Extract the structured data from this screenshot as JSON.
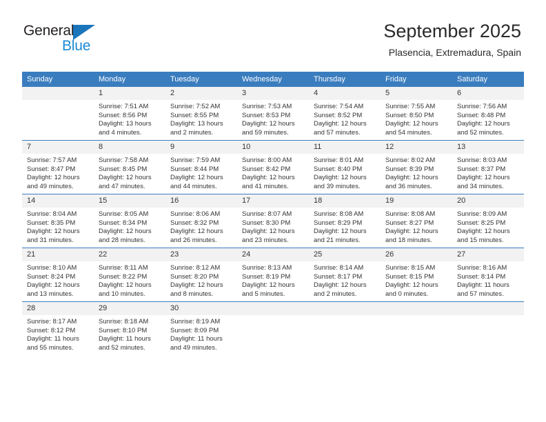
{
  "brand": {
    "name_top": "General",
    "name_bottom": "Blue",
    "accent_color": "#1b75bb",
    "accent_color_light": "#1b8ad4"
  },
  "header": {
    "title": "September 2025",
    "location": "Plasencia, Extremadura, Spain"
  },
  "theme": {
    "header_row_bg": "#3a7dbf",
    "daynum_bg": "#f2f2f2",
    "text_color": "#333333"
  },
  "weekday_headers": [
    "Sunday",
    "Monday",
    "Tuesday",
    "Wednesday",
    "Thursday",
    "Friday",
    "Saturday"
  ],
  "weeks": [
    [
      {
        "day": "",
        "empty": true,
        "sunrise": "",
        "sunset": "",
        "daylight_1": "",
        "daylight_2": ""
      },
      {
        "day": "1",
        "sunrise": "Sunrise: 7:51 AM",
        "sunset": "Sunset: 8:56 PM",
        "daylight_1": "Daylight: 13 hours",
        "daylight_2": "and 4 minutes."
      },
      {
        "day": "2",
        "sunrise": "Sunrise: 7:52 AM",
        "sunset": "Sunset: 8:55 PM",
        "daylight_1": "Daylight: 13 hours",
        "daylight_2": "and 2 minutes."
      },
      {
        "day": "3",
        "sunrise": "Sunrise: 7:53 AM",
        "sunset": "Sunset: 8:53 PM",
        "daylight_1": "Daylight: 12 hours",
        "daylight_2": "and 59 minutes."
      },
      {
        "day": "4",
        "sunrise": "Sunrise: 7:54 AM",
        "sunset": "Sunset: 8:52 PM",
        "daylight_1": "Daylight: 12 hours",
        "daylight_2": "and 57 minutes."
      },
      {
        "day": "5",
        "sunrise": "Sunrise: 7:55 AM",
        "sunset": "Sunset: 8:50 PM",
        "daylight_1": "Daylight: 12 hours",
        "daylight_2": "and 54 minutes."
      },
      {
        "day": "6",
        "sunrise": "Sunrise: 7:56 AM",
        "sunset": "Sunset: 8:48 PM",
        "daylight_1": "Daylight: 12 hours",
        "daylight_2": "and 52 minutes."
      }
    ],
    [
      {
        "day": "7",
        "sunrise": "Sunrise: 7:57 AM",
        "sunset": "Sunset: 8:47 PM",
        "daylight_1": "Daylight: 12 hours",
        "daylight_2": "and 49 minutes."
      },
      {
        "day": "8",
        "sunrise": "Sunrise: 7:58 AM",
        "sunset": "Sunset: 8:45 PM",
        "daylight_1": "Daylight: 12 hours",
        "daylight_2": "and 47 minutes."
      },
      {
        "day": "9",
        "sunrise": "Sunrise: 7:59 AM",
        "sunset": "Sunset: 8:44 PM",
        "daylight_1": "Daylight: 12 hours",
        "daylight_2": "and 44 minutes."
      },
      {
        "day": "10",
        "sunrise": "Sunrise: 8:00 AM",
        "sunset": "Sunset: 8:42 PM",
        "daylight_1": "Daylight: 12 hours",
        "daylight_2": "and 41 minutes."
      },
      {
        "day": "11",
        "sunrise": "Sunrise: 8:01 AM",
        "sunset": "Sunset: 8:40 PM",
        "daylight_1": "Daylight: 12 hours",
        "daylight_2": "and 39 minutes."
      },
      {
        "day": "12",
        "sunrise": "Sunrise: 8:02 AM",
        "sunset": "Sunset: 8:39 PM",
        "daylight_1": "Daylight: 12 hours",
        "daylight_2": "and 36 minutes."
      },
      {
        "day": "13",
        "sunrise": "Sunrise: 8:03 AM",
        "sunset": "Sunset: 8:37 PM",
        "daylight_1": "Daylight: 12 hours",
        "daylight_2": "and 34 minutes."
      }
    ],
    [
      {
        "day": "14",
        "sunrise": "Sunrise: 8:04 AM",
        "sunset": "Sunset: 8:35 PM",
        "daylight_1": "Daylight: 12 hours",
        "daylight_2": "and 31 minutes."
      },
      {
        "day": "15",
        "sunrise": "Sunrise: 8:05 AM",
        "sunset": "Sunset: 8:34 PM",
        "daylight_1": "Daylight: 12 hours",
        "daylight_2": "and 28 minutes."
      },
      {
        "day": "16",
        "sunrise": "Sunrise: 8:06 AM",
        "sunset": "Sunset: 8:32 PM",
        "daylight_1": "Daylight: 12 hours",
        "daylight_2": "and 26 minutes."
      },
      {
        "day": "17",
        "sunrise": "Sunrise: 8:07 AM",
        "sunset": "Sunset: 8:30 PM",
        "daylight_1": "Daylight: 12 hours",
        "daylight_2": "and 23 minutes."
      },
      {
        "day": "18",
        "sunrise": "Sunrise: 8:08 AM",
        "sunset": "Sunset: 8:29 PM",
        "daylight_1": "Daylight: 12 hours",
        "daylight_2": "and 21 minutes."
      },
      {
        "day": "19",
        "sunrise": "Sunrise: 8:08 AM",
        "sunset": "Sunset: 8:27 PM",
        "daylight_1": "Daylight: 12 hours",
        "daylight_2": "and 18 minutes."
      },
      {
        "day": "20",
        "sunrise": "Sunrise: 8:09 AM",
        "sunset": "Sunset: 8:25 PM",
        "daylight_1": "Daylight: 12 hours",
        "daylight_2": "and 15 minutes."
      }
    ],
    [
      {
        "day": "21",
        "sunrise": "Sunrise: 8:10 AM",
        "sunset": "Sunset: 8:24 PM",
        "daylight_1": "Daylight: 12 hours",
        "daylight_2": "and 13 minutes."
      },
      {
        "day": "22",
        "sunrise": "Sunrise: 8:11 AM",
        "sunset": "Sunset: 8:22 PM",
        "daylight_1": "Daylight: 12 hours",
        "daylight_2": "and 10 minutes."
      },
      {
        "day": "23",
        "sunrise": "Sunrise: 8:12 AM",
        "sunset": "Sunset: 8:20 PM",
        "daylight_1": "Daylight: 12 hours",
        "daylight_2": "and 8 minutes."
      },
      {
        "day": "24",
        "sunrise": "Sunrise: 8:13 AM",
        "sunset": "Sunset: 8:19 PM",
        "daylight_1": "Daylight: 12 hours",
        "daylight_2": "and 5 minutes."
      },
      {
        "day": "25",
        "sunrise": "Sunrise: 8:14 AM",
        "sunset": "Sunset: 8:17 PM",
        "daylight_1": "Daylight: 12 hours",
        "daylight_2": "and 2 minutes."
      },
      {
        "day": "26",
        "sunrise": "Sunrise: 8:15 AM",
        "sunset": "Sunset: 8:15 PM",
        "daylight_1": "Daylight: 12 hours",
        "daylight_2": "and 0 minutes."
      },
      {
        "day": "27",
        "sunrise": "Sunrise: 8:16 AM",
        "sunset": "Sunset: 8:14 PM",
        "daylight_1": "Daylight: 11 hours",
        "daylight_2": "and 57 minutes."
      }
    ],
    [
      {
        "day": "28",
        "sunrise": "Sunrise: 8:17 AM",
        "sunset": "Sunset: 8:12 PM",
        "daylight_1": "Daylight: 11 hours",
        "daylight_2": "and 55 minutes."
      },
      {
        "day": "29",
        "sunrise": "Sunrise: 8:18 AM",
        "sunset": "Sunset: 8:10 PM",
        "daylight_1": "Daylight: 11 hours",
        "daylight_2": "and 52 minutes."
      },
      {
        "day": "30",
        "sunrise": "Sunrise: 8:19 AM",
        "sunset": "Sunset: 8:09 PM",
        "daylight_1": "Daylight: 11 hours",
        "daylight_2": "and 49 minutes."
      },
      {
        "day": "",
        "empty": true,
        "sunrise": "",
        "sunset": "",
        "daylight_1": "",
        "daylight_2": ""
      },
      {
        "day": "",
        "empty": true,
        "sunrise": "",
        "sunset": "",
        "daylight_1": "",
        "daylight_2": ""
      },
      {
        "day": "",
        "empty": true,
        "sunrise": "",
        "sunset": "",
        "daylight_1": "",
        "daylight_2": ""
      },
      {
        "day": "",
        "empty": true,
        "sunrise": "",
        "sunset": "",
        "daylight_1": "",
        "daylight_2": ""
      }
    ]
  ]
}
